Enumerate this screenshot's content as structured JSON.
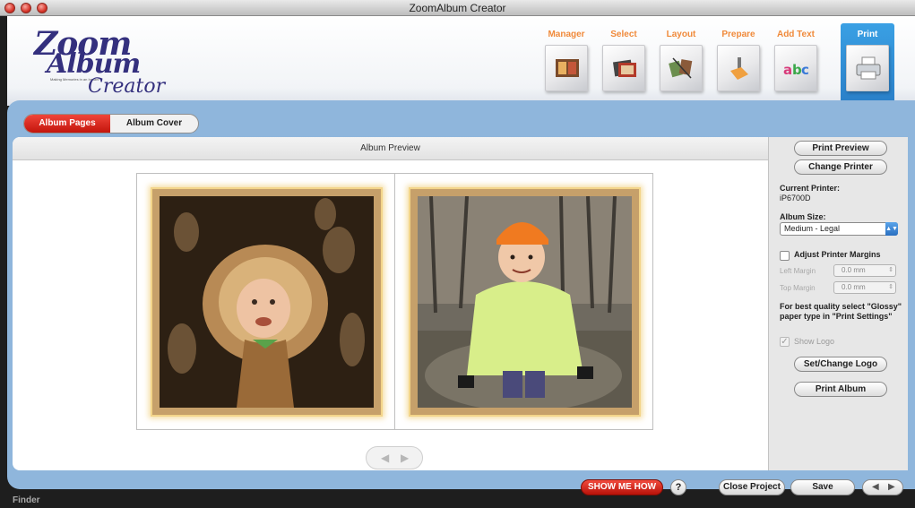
{
  "window": {
    "title": "ZoomAlbum Creator"
  },
  "logo": {
    "line1": "Zoom",
    "line2": "Album",
    "tagline": "Making Memories in an Instant",
    "line3": "Creator"
  },
  "steps": [
    {
      "label": "Manager",
      "icon": "album-photos-icon",
      "active": false
    },
    {
      "label": "Select",
      "icon": "photo-stack-icon",
      "active": false
    },
    {
      "label": "Layout",
      "icon": "layout-pages-icon",
      "active": false
    },
    {
      "label": "Prepare",
      "icon": "hand-tool-icon",
      "active": false
    },
    {
      "label": "Add Text",
      "icon": "abc-text-icon",
      "active": false
    },
    {
      "label": "Print",
      "icon": "printer-icon",
      "active": true
    }
  ],
  "tabs": {
    "pages": "Album Pages",
    "cover": "Album Cover"
  },
  "preview": {
    "title": "Album Preview"
  },
  "side": {
    "print_preview": "Print Preview",
    "change_printer": "Change Printer",
    "current_printer_label": "Current Printer:",
    "current_printer_value": "iP6700D",
    "album_size_label": "Album Size:",
    "album_size_value": "Medium - Legal",
    "adjust_margins_label": "Adjust Printer Margins",
    "left_margin_label": "Left Margin",
    "left_margin_value": "0.0 mm",
    "top_margin_label": "Top Margin",
    "top_margin_value": "0.0 mm",
    "hint_line1": "For best quality select \"Glossy\"",
    "hint_line2": "paper type in \"Print Settings\"",
    "show_logo_label": "Show Logo",
    "set_logo": "Set/Change Logo",
    "print_album": "Print Album"
  },
  "bottom": {
    "show_me_how": "SHOW ME HOW",
    "help": "?",
    "close_project": "Close Project",
    "save": "Save",
    "finder": "Finder"
  },
  "colors": {
    "accent_red": "#d8251a",
    "step_orange": "#f08a3a",
    "active_blue": "#2f8ad6",
    "frame_blue": "#8fb6dc"
  }
}
